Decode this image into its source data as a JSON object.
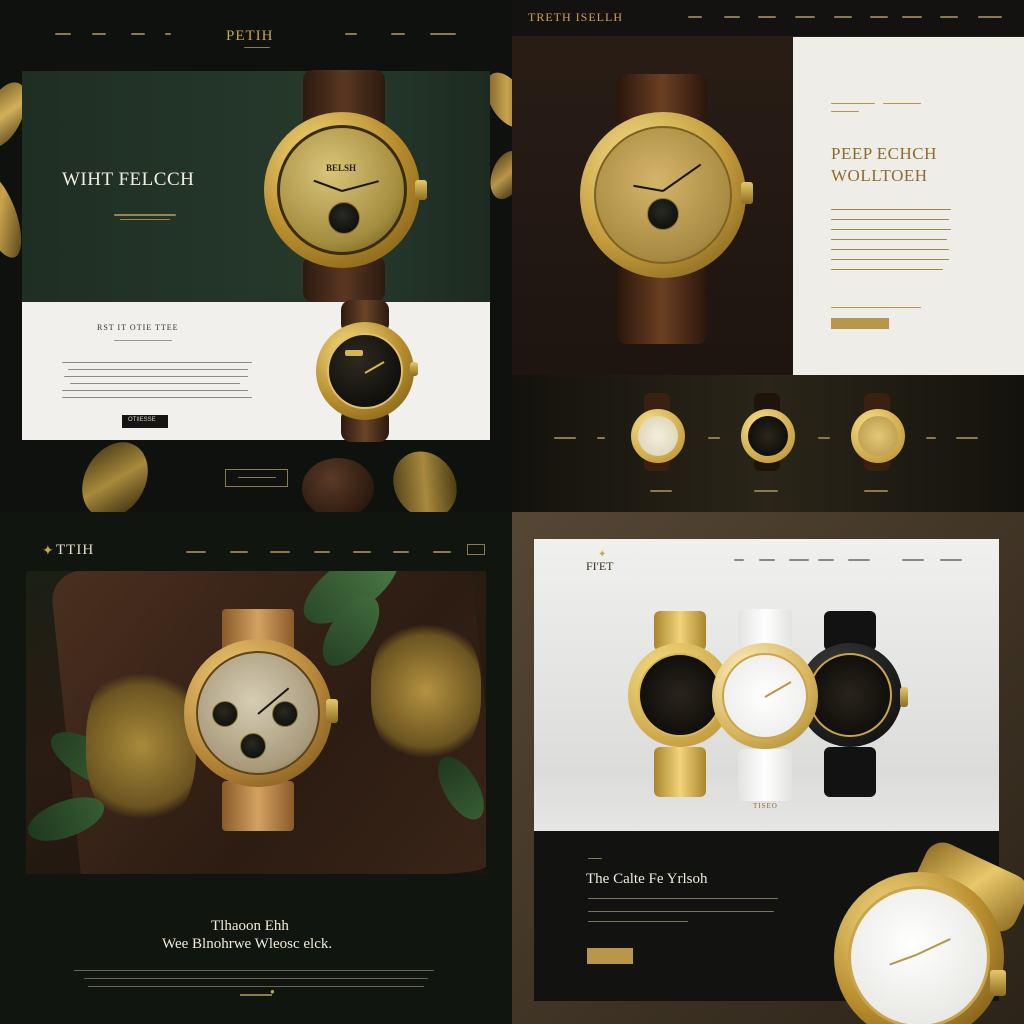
{
  "colors": {
    "gold": "#c9a44c",
    "dark_green": "#1f2c22",
    "dark_brown": "#2a1e16",
    "cream": "#eeede8",
    "near_black": "#0f110e"
  },
  "panel_tl": {
    "brand": "PETIH",
    "hero_title": "WIHT FELCCH",
    "section_title": "RST IT OTIE TTEE",
    "button_label": "OTIIESSE"
  },
  "panel_tr": {
    "brand": "TRETH ISELLH",
    "heading_line1": "PEEP ECHCH",
    "heading_line2": "WOLLTOEH"
  },
  "panel_bl": {
    "brand": "TTIH",
    "heading_line1": "Tlhaoon Ehh",
    "heading_line2": "Wee Blnohrwe Wleosc elck."
  },
  "panel_br": {
    "brand": "FI'ET",
    "caption": "TISEO",
    "feature_title": "The Calte Fe Yrlsoh"
  }
}
